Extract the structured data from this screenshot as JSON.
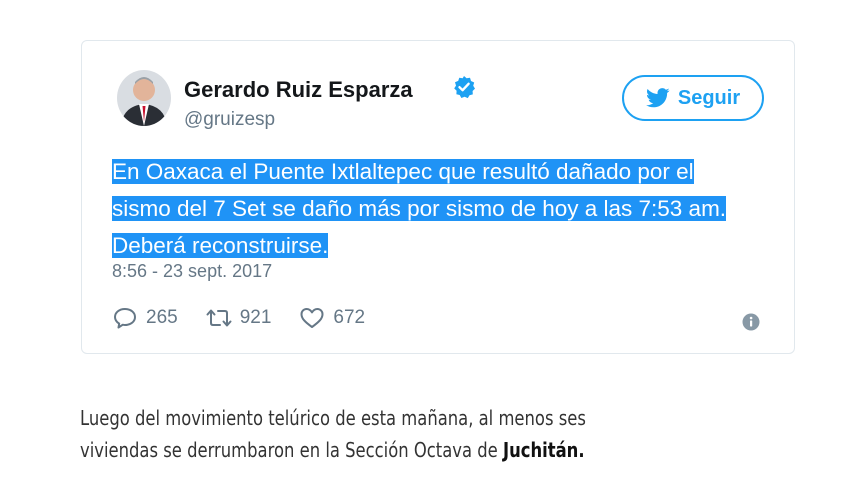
{
  "tweet": {
    "author_name": "Gerardo Ruiz Esparza",
    "handle": "@gruizesp",
    "follow_label": "Seguir",
    "text": "En Oaxaca el Puente Ixtlaltepec que resultó dañado por el sismo del 7 Set se daño más por sismo de hoy a las 7:53 am. Deberá reconstruirse.",
    "timestamp": "8:56 - 23 sept. 2017",
    "replies": "265",
    "retweets": "921",
    "likes": "672"
  },
  "caption": {
    "text": "Luego del movimiento telúrico de esta mañana, al menos ses viviendas se derrumbaron en la Sección Octava de ",
    "bold": "Juchitán."
  },
  "colors": {
    "accent": "#1da1f2",
    "highlight": "#1f93f6",
    "muted": "#657786"
  }
}
